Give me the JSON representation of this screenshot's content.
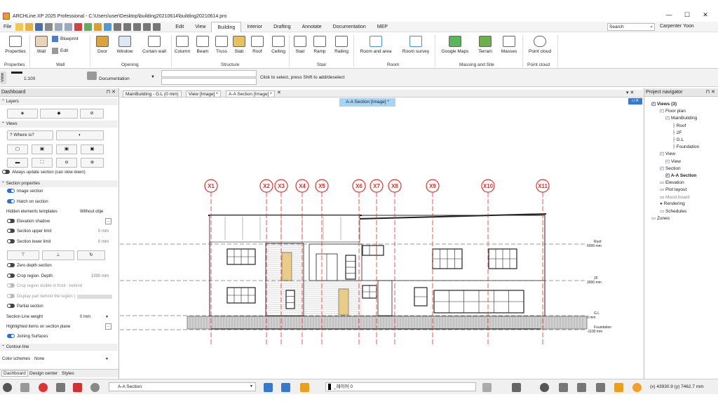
{
  "title": "ARCHLine.XP 2025 Professional - C:\\Users\\user\\Desktop\\building20210614\\building20210614.pro",
  "menu": {
    "file": "File",
    "tabs": [
      "Edit",
      "View",
      "Building",
      "Interior",
      "Drafting",
      "Annotate",
      "Documentation",
      "MEP"
    ],
    "active_tab": "Building"
  },
  "search": {
    "label": "Search"
  },
  "user": "Carpenter Yoon",
  "ribbon": {
    "buttons": [
      {
        "label": "Properties"
      },
      {
        "label": "Wall"
      },
      {
        "label": "Blueprint"
      },
      {
        "label": "Edit"
      },
      {
        "label": "Door"
      },
      {
        "label": "Window"
      },
      {
        "label": "Curtain wall"
      },
      {
        "label": "Column"
      },
      {
        "label": "Beam"
      },
      {
        "label": "Truss"
      },
      {
        "label": "Slab"
      },
      {
        "label": "Roof"
      },
      {
        "label": "Ceiling"
      },
      {
        "label": "Stair"
      },
      {
        "label": "Ramp"
      },
      {
        "label": "Railing"
      },
      {
        "label": "Room and area"
      },
      {
        "label": "Room survey"
      },
      {
        "label": "Google Maps"
      },
      {
        "label": "Terrain"
      },
      {
        "label": "Masses"
      },
      {
        "label": "Point cloud"
      }
    ],
    "groups": [
      "Properties",
      "Wall",
      "Opening",
      "Structure",
      "Stair",
      "Room",
      "Massing and Site",
      "Point cloud"
    ]
  },
  "viewbar": {
    "label": "View",
    "scale": "1:100",
    "documentation": "Documentation",
    "hint": "Click to select, press Shift to add/deselect"
  },
  "dashboard": {
    "title": "Dashboard",
    "layers": "Layers",
    "views": "Views",
    "where_is": "Where is?",
    "always_update": "Always update section (can slow down)",
    "section_properties": "Section properties",
    "image_section": "Image section",
    "hatch_on_section": "Hatch on section",
    "hidden_templates": "Hidden elements templates",
    "hidden_value": "Without obje",
    "elevation_shadow": "Elevation shadow",
    "upper_limit": "Section upper limit",
    "upper_value": "0 mm",
    "lower_limit": "Section lower limit",
    "lower_value": "0 mm",
    "zero_depth": "Zero depth section",
    "crop_region": "Crop region. Depth:",
    "crop_value": "1000 mm",
    "crop_visible": "Crop region visible in front - behind",
    "display_part": "Display part behind the region (",
    "partial": "Partial section",
    "line_weight": "Section Line weight",
    "line_weight_value": "0 mm",
    "highlighted": "Highlighted items on section plane",
    "joining": "Joining Surfaces",
    "contour": "Contour-line",
    "color_schemes": "Color schemes",
    "color_value": "None",
    "bottom_tabs": [
      "Dashboard",
      "Design center",
      "Styles"
    ]
  },
  "doc_tabs": [
    "MainBuilding - G.L (0 mm)",
    "View [Image] *",
    "A-A Section [Image] *"
  ],
  "view_label": "A-A Section [Image] *",
  "drawing": {
    "grid_labels": [
      "X1",
      "X2",
      "X3",
      "X4",
      "X5",
      "X6",
      "X7",
      "X8",
      "X9",
      "X10",
      "X11"
    ],
    "levels": [
      {
        "name": "Roof",
        "value": "6000 mm"
      },
      {
        "name": "2F",
        "value": "3000 mm"
      },
      {
        "name": "G.L",
        "value": "0 mm"
      },
      {
        "name": "Foundation",
        "value": "-1100 mm"
      }
    ]
  },
  "navigator": {
    "title": "Project navigator",
    "items": [
      {
        "label": "Views (3)",
        "bold": true
      },
      {
        "label": "Floor plan"
      },
      {
        "label": "MainBuilding"
      },
      {
        "label": "Roof"
      },
      {
        "label": "2F"
      },
      {
        "label": "G.L"
      },
      {
        "label": "Foundation"
      },
      {
        "label": "View"
      },
      {
        "label": "View"
      },
      {
        "label": "Section"
      },
      {
        "label": "A-A Section",
        "bold": true
      },
      {
        "label": "Elevation"
      },
      {
        "label": "Plot layout"
      },
      {
        "label": "Mood board"
      },
      {
        "label": "Rendering"
      },
      {
        "label": "Schedules"
      },
      {
        "label": "Zones"
      }
    ]
  },
  "statusbar": {
    "view": "A-A Section",
    "layer": "_레이어 0",
    "coords": "(x) 43930.9  (y) 7462.7 mm"
  },
  "colors": {
    "accent": "#2a6fd4",
    "grid": "#e03030",
    "tab_active": "#a8d3f3"
  }
}
